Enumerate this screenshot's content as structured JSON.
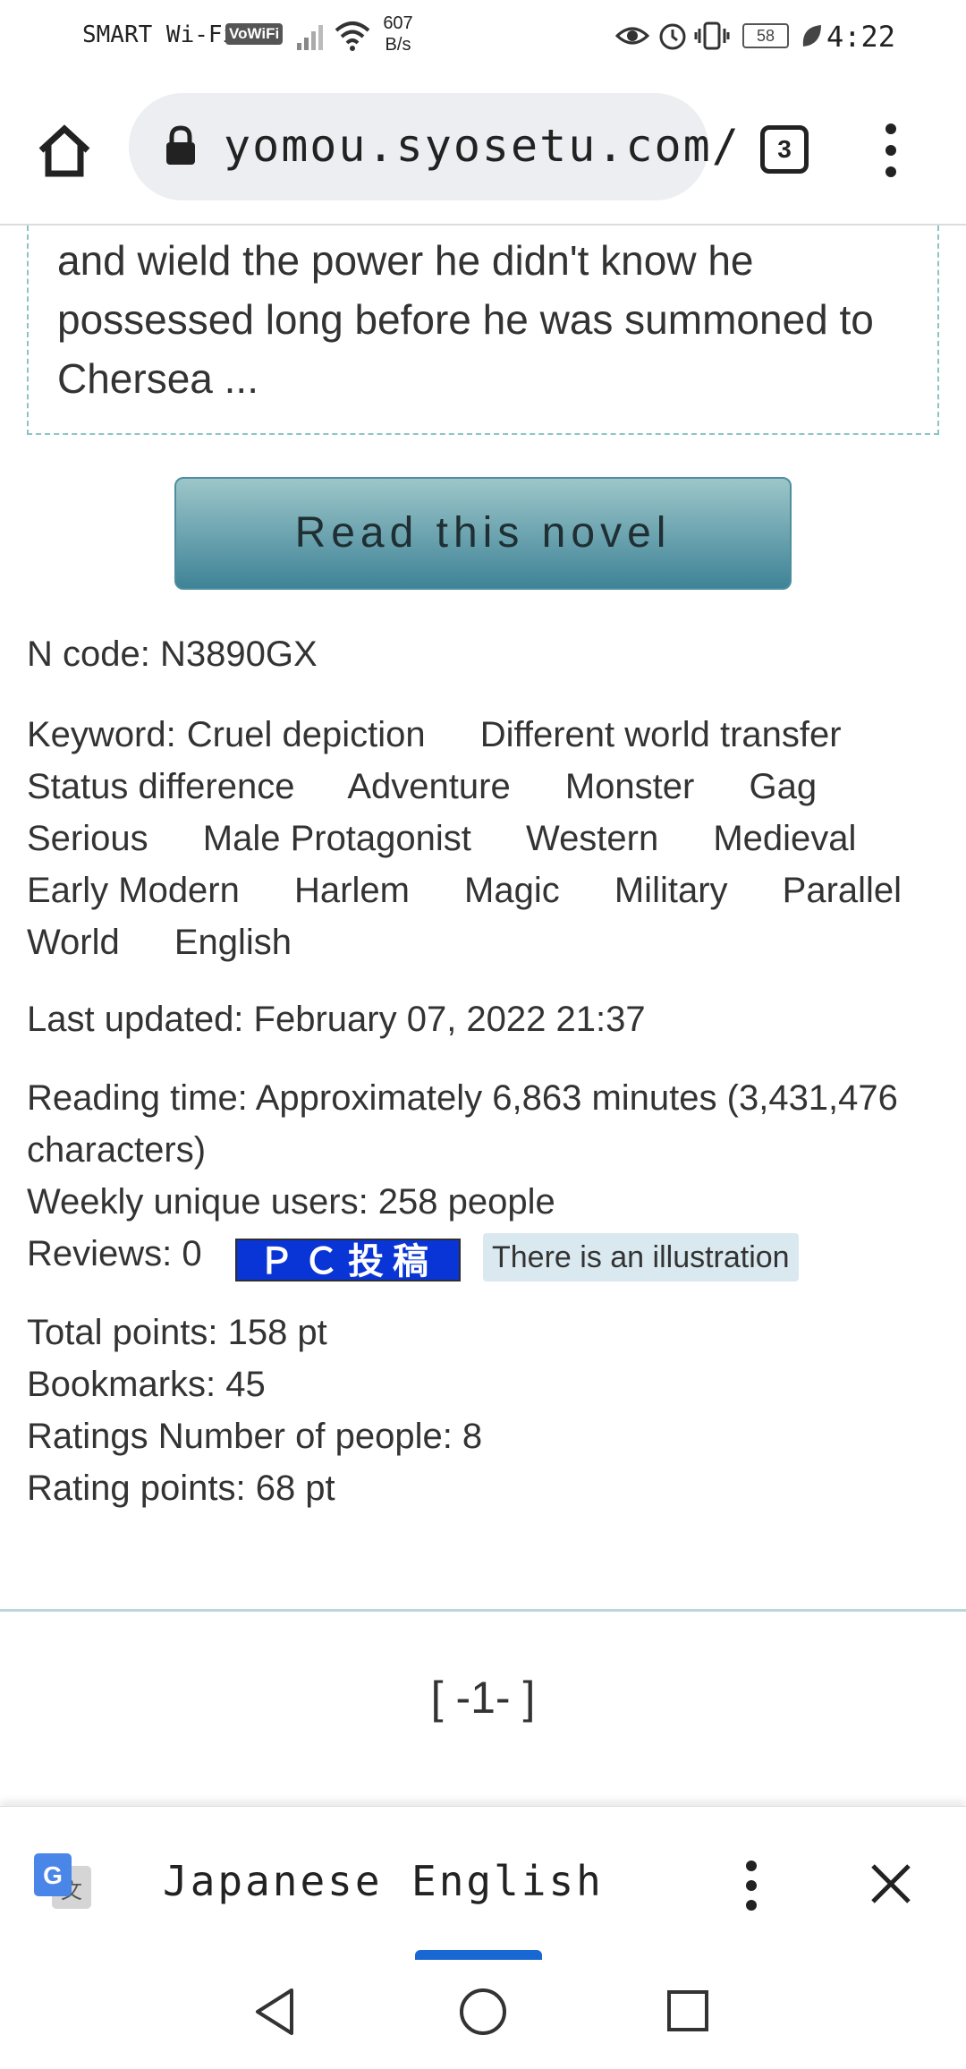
{
  "status_bar": {
    "carrier": "SMART Wi-Fi",
    "vowifi": "VoWiFi",
    "speed_value": "607",
    "speed_unit": "B/s",
    "battery": "58",
    "time": "4:22"
  },
  "browser": {
    "url": "yomou.syosetu.com/",
    "tab_count": "3"
  },
  "summary": {
    "text": "and wield the power he didn't know he possessed long before he was summoned to Chersea ..."
  },
  "read_button": "Read this novel",
  "info": {
    "ncode": "N code: N3890GX",
    "keyword_label": "Keyword:",
    "keywords": [
      "Cruel depiction",
      "Different world transfer",
      "Status difference",
      "Adventure",
      "Monster",
      "Gag",
      "Serious",
      "Male Protagonist",
      "Western",
      "Medieval",
      "Early Modern",
      "Harlem",
      "Magic",
      "Military",
      "Parallel World",
      "English"
    ],
    "last_updated": "Last updated: February 07, 2022 21:37",
    "reading_time": "Reading time: Approximately 6,863 minutes (3,431,476",
    "reading_time_cont": "characters)",
    "weekly_users": "Weekly unique users: 258 people",
    "reviews": "Reviews: 0",
    "pc_badge": "ＰＣ投稿",
    "illustration_badge": "There is an illustration",
    "total_points": "Total points: 158 pt",
    "bookmarks": "Bookmarks: 45",
    "ratings_people": "Ratings Number of people: 8",
    "rating_points": "Rating points: 68 pt"
  },
  "pager": "[ -1- ]",
  "translate": {
    "source_lang": "Japanese",
    "target_lang": "English",
    "active": "English"
  },
  "icons": {
    "home": "home-icon",
    "lock": "lock-icon",
    "menu": "more-vert-icon",
    "translate": "google-translate-icon",
    "close": "close-icon",
    "back": "back-triangle-icon",
    "home_nav": "home-circle-icon",
    "recents": "recents-square-icon"
  },
  "colors": {
    "button_top": "#9cc6c9",
    "button_bottom": "#3f8397",
    "pc_badge_bg": "#0a35d6",
    "illustration_bg": "#d9e9ef",
    "active_tab": "#1967d2"
  }
}
